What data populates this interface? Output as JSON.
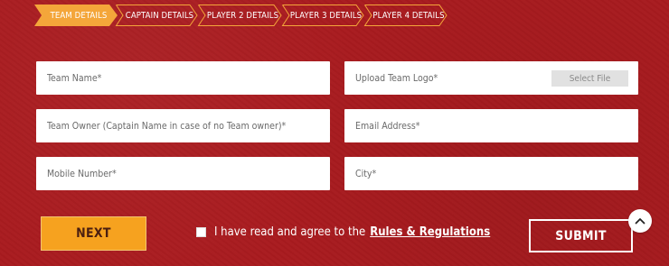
{
  "steps": [
    {
      "label": "TEAM DETAILS",
      "active": true
    },
    {
      "label": "CAPTAIN DETAILS",
      "active": false
    },
    {
      "label": "PLAYER 2 DETAILS",
      "active": false
    },
    {
      "label": "PLAYER 3 DETAILS",
      "active": false
    },
    {
      "label": "PLAYER 4 DETAILS",
      "active": false
    }
  ],
  "form": {
    "team_name": {
      "placeholder": "Team Name*",
      "value": ""
    },
    "team_logo": {
      "placeholder": "Upload Team Logo*",
      "button": "Select File"
    },
    "team_owner": {
      "placeholder": "Team Owner (Captain Name in case of no Team owner)*",
      "value": ""
    },
    "email": {
      "placeholder": "Email Address*",
      "value": ""
    },
    "mobile": {
      "placeholder": "Mobile Number*",
      "value": ""
    },
    "city": {
      "placeholder": "City*",
      "value": ""
    }
  },
  "actions": {
    "next_label": "NEXT",
    "agree_text": "I have read and agree to the",
    "rules_link": "Rules & Regulations",
    "agree_checked": false,
    "submit_label": "SUBMIT"
  },
  "icons": {
    "scroll_top": "chevron-up-icon",
    "step_arrow": "chevron-right-icon"
  },
  "colors": {
    "background": "#a91b1f",
    "accent": "#f6a21f",
    "step_outline": "#f4a63a",
    "field": "#ffffff",
    "text_light": "#ffffff"
  }
}
